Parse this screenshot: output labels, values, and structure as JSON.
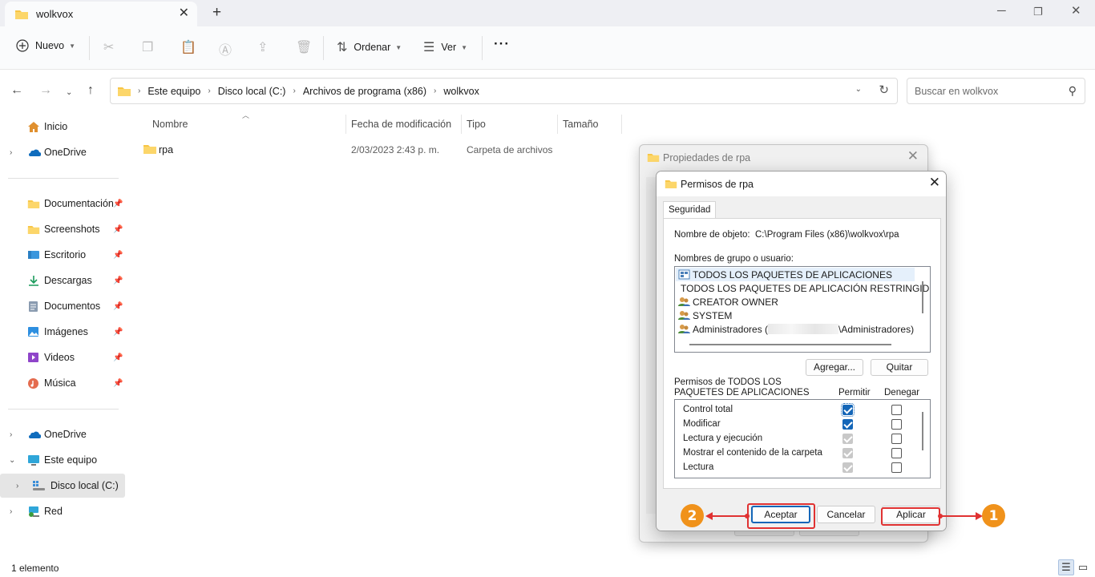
{
  "window": {
    "tab_title": "wolkvox",
    "minimize_icon": "minimize-icon",
    "maximize_icon": "maximize-icon",
    "close_icon": "close-icon"
  },
  "toolbar": {
    "new_label": "Nuevo",
    "sort_label": "Ordenar",
    "view_label": "Ver",
    "more_label": "···"
  },
  "address": {
    "crumbs": [
      "Este equipo",
      "Disco local (C:)",
      "Archivos de programa (x86)",
      "wolkvox"
    ]
  },
  "search": {
    "placeholder": "Buscar en wolkvox"
  },
  "sidebar": {
    "home": "Inicio",
    "onedrive_top": "OneDrive",
    "pinned": [
      "Documentación",
      "Screenshots",
      "Escritorio",
      "Descargas",
      "Documentos",
      "Imágenes",
      "Videos",
      "Música"
    ],
    "onedrive": "OneDrive",
    "this_pc": "Este equipo",
    "local_disk": "Disco local (C:)",
    "network": "Red"
  },
  "columns": {
    "name": "Nombre",
    "modified": "Fecha de modificación",
    "type": "Tipo",
    "size": "Tamaño"
  },
  "files": [
    {
      "name": "rpa",
      "modified": "2/03/2023 2:43 p. m.",
      "type": "Carpeta de archivos",
      "size": ""
    }
  ],
  "status": {
    "item_count": "1 elemento"
  },
  "back_dialog": {
    "title": "Propiedades de rpa"
  },
  "dialog": {
    "title": "Permisos de rpa",
    "tab": "Seguridad",
    "object_label": "Nombre de objeto:",
    "object_value": "C:\\Program Files (x86)\\wolkvox\\rpa",
    "groups_label": "Nombres de grupo o usuario:",
    "groups": [
      "TODOS LOS PAQUETES DE APLICACIONES",
      "TODOS LOS PAQUETES DE APLICACIÓN RESTRINGID",
      "CREATOR OWNER",
      "SYSTEM"
    ],
    "admins_prefix": "Administradores (",
    "admins_suffix": "\\Administradores)",
    "add_button": "Agregar...",
    "remove_button": "Quitar",
    "perms_label_line1": "Permisos de TODOS LOS",
    "perms_label_line2": "PAQUETES DE APLICACIONES",
    "allow_header": "Permitir",
    "deny_header": "Denegar",
    "permissions": [
      {
        "name": "Control total",
        "allow": "checked",
        "deny": "unchecked"
      },
      {
        "name": "Modificar",
        "allow": "checked",
        "deny": "unchecked"
      },
      {
        "name": "Lectura y ejecución",
        "allow": "grey",
        "deny": "unchecked"
      },
      {
        "name": "Mostrar el contenido de la carpeta",
        "allow": "grey",
        "deny": "unchecked"
      },
      {
        "name": "Lectura",
        "allow": "grey",
        "deny": "unchecked"
      }
    ],
    "ok_button": "Aceptar",
    "cancel_button": "Cancelar",
    "apply_button": "Aplicar"
  },
  "annotations": {
    "badge_apply": "1",
    "badge_ok": "2"
  },
  "colors": {
    "accent": "#1466b8",
    "annotation_red": "#e03232",
    "annotation_badge": "#f0921b",
    "folder_yellow": "#f8c544"
  }
}
